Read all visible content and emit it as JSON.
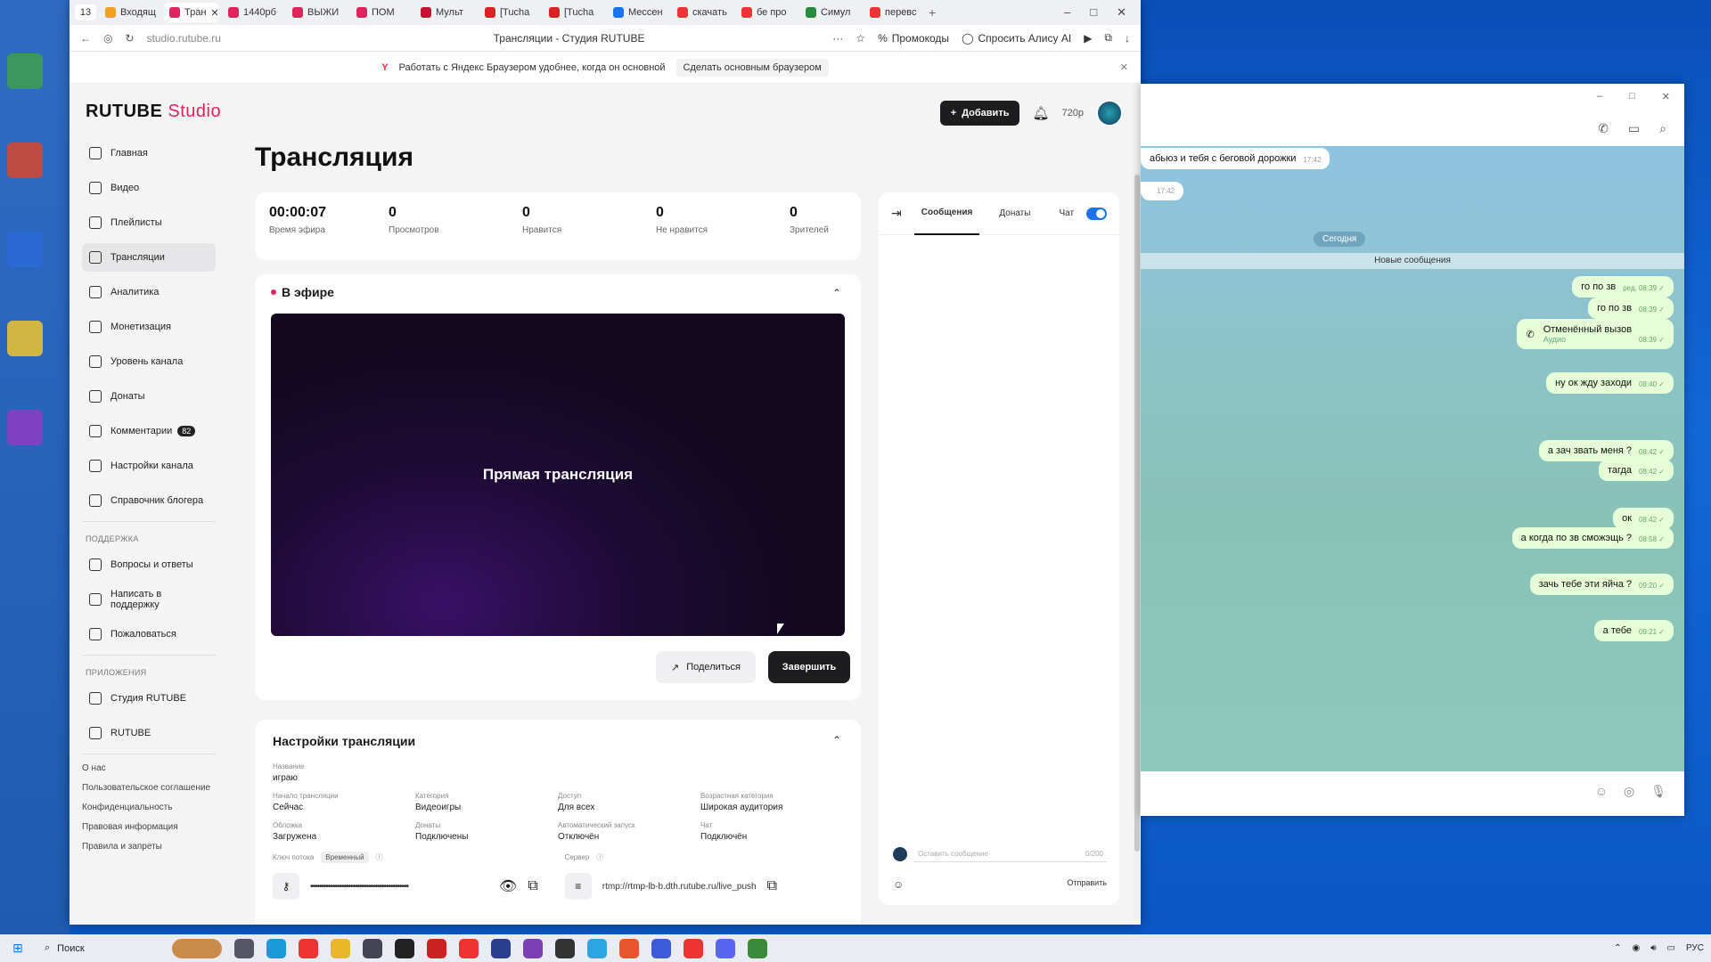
{
  "browser": {
    "tab_count": "13",
    "tabs": [
      {
        "label": "Входящ",
        "color": "#f0a020"
      },
      {
        "label": "Тран",
        "color": "#e0245e",
        "active": true
      },
      {
        "label": "1440рб",
        "color": "#e0245e"
      },
      {
        "label": "ВЫЖИ",
        "color": "#e0245e"
      },
      {
        "label": "ПОМ",
        "color": "#e0245e"
      },
      {
        "label": "Мульт",
        "color": "#c4122f"
      },
      {
        "label": "[Tucha",
        "color": "#d22"
      },
      {
        "label": "[Tucha",
        "color": "#d22"
      },
      {
        "label": "Мессен",
        "color": "#1a73e8"
      },
      {
        "label": "скачать",
        "color": "#e33"
      },
      {
        "label": "бе про",
        "color": "#e33"
      },
      {
        "label": "Симул",
        "color": "#2a8a3a"
      },
      {
        "label": "перевс",
        "color": "#e33"
      }
    ],
    "url": "studio.rutube.ru",
    "page_title": "Трансляции - Студия RUTUBE",
    "promo_label": "Промокоды",
    "alice_label": "Спросить Алису AI",
    "infobar_text": "Работать с Яндекс Браузером удобнее, когда он основной",
    "infobar_button": "Сделать основным браузером"
  },
  "app": {
    "logo_main": "RUTUBE",
    "logo_studio": "Studio",
    "add_button": "Добавить",
    "quality": "720p",
    "sidebar": {
      "items": [
        {
          "label": "Главная",
          "name": "home"
        },
        {
          "label": "Видео",
          "name": "video"
        },
        {
          "label": "Плейлисты",
          "name": "playlists"
        },
        {
          "label": "Трансляции",
          "name": "streams",
          "active": true
        },
        {
          "label": "Аналитика",
          "name": "analytics"
        },
        {
          "label": "Монетизация",
          "name": "monetization"
        },
        {
          "label": "Уровень канала",
          "name": "channel-level"
        },
        {
          "label": "Донаты",
          "name": "donations"
        },
        {
          "label": "Комментарии",
          "name": "comments",
          "badge": "82"
        },
        {
          "label": "Настройки канала",
          "name": "channel-settings"
        },
        {
          "label": "Справочник блогера",
          "name": "blogger-guide"
        }
      ],
      "support_title": "ПОДДЕРЖКА",
      "support": [
        {
          "label": "Вопросы и ответы"
        },
        {
          "label": "Написать в поддержку"
        },
        {
          "label": "Пожаловаться"
        }
      ],
      "apps_title": "ПРИЛОЖЕНИЯ",
      "apps": [
        {
          "label": "Студия RUTUBE"
        },
        {
          "label": "RUTUBE"
        }
      ],
      "footer": [
        "О нас",
        "Пользовательское соглашение",
        "Конфиденциальность",
        "Правовая информация",
        "Правила и запреты"
      ]
    },
    "title": "Трансляция",
    "stats": [
      {
        "value": "00:00:07",
        "label": "Время эфира"
      },
      {
        "value": "0",
        "label": "Просмотров"
      },
      {
        "value": "0",
        "label": "Нравится"
      },
      {
        "value": "0",
        "label": "Не нравится"
      },
      {
        "value": "0",
        "label": "Зрителей"
      }
    ],
    "live_title": "В эфире",
    "player_text": "Прямая трансляция",
    "share_button": "Поделиться",
    "end_button": "Завершить",
    "settings": {
      "title": "Настройки трансляции",
      "name_label": "Название",
      "name_value": "играю",
      "fields": [
        {
          "k": "Начало трансляции",
          "v": "Сейчас"
        },
        {
          "k": "Категория",
          "v": "Видеоигры"
        },
        {
          "k": "Доступ",
          "v": "Для всех"
        },
        {
          "k": "Возрастная категория",
          "v": "Широкая аудитория"
        },
        {
          "k": "Обложка",
          "v": "Загружена"
        },
        {
          "k": "Донаты",
          "v": "Подключены"
        },
        {
          "k": "Автоматический запуск",
          "v": "Отключён"
        },
        {
          "k": "Чат",
          "v": "Подключён"
        }
      ],
      "key_label": "Ключ потока",
      "key_temp": "Временный",
      "key_masked": "••••••••••••••••••••••••••••••••••••••••••••",
      "server_label": "Сервер",
      "server_value": "rtmp://rtmp-lb-b.dth.rutube.ru/live_push"
    },
    "chat": {
      "tab_messages": "Сообщения",
      "tab_donations": "Донаты",
      "chat_label": "Чат",
      "placeholder": "Оставить сообщение",
      "counter": "0/200",
      "send": "Отправить"
    }
  },
  "telegram": {
    "messages": [
      {
        "text": "абьюз и тебя с беговой дорожки",
        "time": "17:42",
        "dir": "in"
      },
      {
        "text": "",
        "time": "17:42",
        "dir": "in"
      },
      {
        "text": "го по зв",
        "time": "ред. 08:39",
        "dir": "out"
      },
      {
        "text": "го по зв",
        "time": "08:39",
        "dir": "out"
      },
      {
        "text": "Отменённый вызов",
        "sub": "Аудио",
        "time": "08:39",
        "dir": "out"
      },
      {
        "text": "ну ок жду заходи",
        "time": "08:40",
        "dir": "out"
      },
      {
        "text": "а зач звать меня ?",
        "time": "08:42",
        "dir": "out"
      },
      {
        "text": "тагда",
        "time": "08:42",
        "dir": "out"
      },
      {
        "text": "ок",
        "time": "08:42",
        "dir": "out"
      },
      {
        "text": "а когда по зв сможэщь ?",
        "time": "08:58",
        "dir": "out"
      },
      {
        "text": "зачь тебе эти яйча ?",
        "time": "09:20",
        "dir": "out"
      },
      {
        "text": "а тебе",
        "time": "09:21",
        "dir": "out"
      }
    ],
    "date_chip": "Сегодня",
    "new_messages": "Новые сообщения"
  },
  "taskbar": {
    "search": "Поиск",
    "lang": "РУС"
  }
}
